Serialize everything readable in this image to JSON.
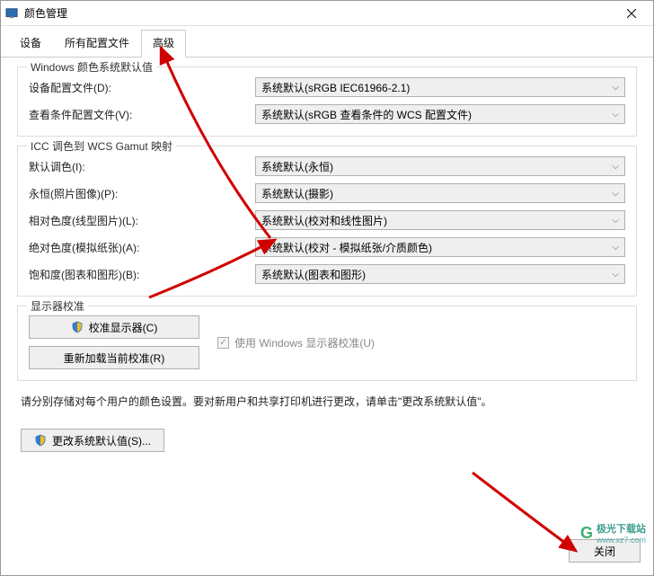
{
  "titlebar": {
    "title": "颜色管理"
  },
  "tabs": {
    "devices": "设备",
    "profiles": "所有配置文件",
    "advanced": "高级"
  },
  "group1": {
    "title": "Windows 颜色系统默认值",
    "row1_label": "设备配置文件(D):",
    "row1_value": "系统默认(sRGB IEC61966-2.1)",
    "row2_label": "查看条件配置文件(V):",
    "row2_value": "系统默认(sRGB 查看条件的 WCS 配置文件)"
  },
  "group2": {
    "title": "ICC 调色到 WCS Gamut 映射",
    "r1_label": "默认调色(I):",
    "r1_value": "系统默认(永恒)",
    "r2_label": "永恒(照片图像)(P):",
    "r2_value": "系统默认(摄影)",
    "r3_label": "相对色度(线型图片)(L):",
    "r3_value": "系统默认(校对和线性图片)",
    "r4_label": "绝对色度(模拟纸张)(A):",
    "r4_value": "系统默认(校对 - 模拟纸张/介质颜色)",
    "r5_label": "饱和度(图表和图形)(B):",
    "r5_value": "系统默认(图表和图形)"
  },
  "group3": {
    "title": "显示器校准",
    "btn_calibrate": "校准显示器(C)",
    "btn_reload": "重新加载当前校准(R)",
    "chk_label": "使用 Windows 显示器校准(U)"
  },
  "note": "请分别存储对每个用户的颜色设置。要对新用户和共享打印机进行更改，请单击\"更改系统默认值\"。",
  "btn_change_default": "更改系统默认值(S)...",
  "btn_close": "关闭",
  "watermark": {
    "brand": "极光下载站",
    "url": "www.xz7.com"
  }
}
